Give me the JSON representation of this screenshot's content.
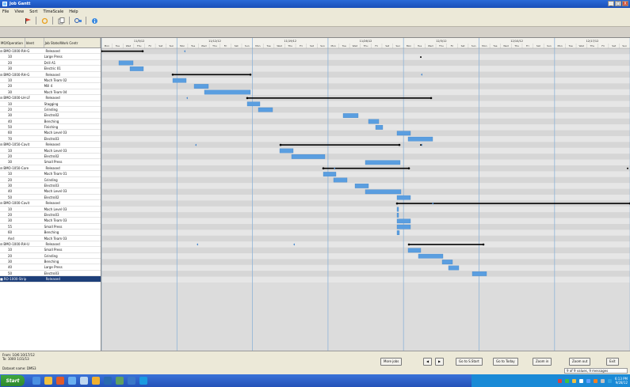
{
  "window": {
    "title": "Job Gantt",
    "controls": [
      "_",
      "□",
      "X"
    ]
  },
  "menu": [
    "File",
    "View",
    "Sort",
    "TimeScale",
    "Help"
  ],
  "toolbar": {
    "icons": [
      "flag-icon",
      "refresh-icon",
      "copy-icon",
      "zoom-icon",
      "info-icon"
    ]
  },
  "grid": {
    "headers": [
      "MO/Operation",
      "Ident",
      "Job State/Work Centr"
    ],
    "rows": [
      {
        "type": "parent",
        "c1": "BMO-1000-RH-G",
        "c2": "Released"
      },
      {
        "type": "child",
        "c1": "10",
        "c2": "Large Press"
      },
      {
        "type": "child",
        "c1": "20",
        "c2": "Drill A1"
      },
      {
        "type": "child",
        "c1": "30",
        "c2": "Electric 01"
      },
      {
        "type": "parent",
        "c1": "BMO-1000-RH-G",
        "c2": "Released"
      },
      {
        "type": "child",
        "c1": "10",
        "c2": "Mach Team 02"
      },
      {
        "type": "child",
        "c1": "20",
        "c2": "Mill 4"
      },
      {
        "type": "child",
        "c1": "30",
        "c2": "Mach Team 04"
      },
      {
        "type": "parent",
        "c1": "BMO-1000-LH-LF",
        "c2": "Released"
      },
      {
        "type": "child",
        "c1": "10",
        "c2": "Stagging"
      },
      {
        "type": "child",
        "c1": "20",
        "c2": "Grinding"
      },
      {
        "type": "child",
        "c1": "30",
        "c2": "Electro02"
      },
      {
        "type": "child",
        "c1": "40",
        "c2": "Benching"
      },
      {
        "type": "child",
        "c1": "50",
        "c2": "Finishing"
      },
      {
        "type": "child",
        "c1": "60",
        "c2": "Mach Level 03"
      },
      {
        "type": "child",
        "c1": "70",
        "c2": "Electro03"
      },
      {
        "type": "parent",
        "c1": "BMO-1050-Cavit",
        "c2": "Released"
      },
      {
        "type": "child",
        "c1": "10",
        "c2": "Mach Level 03"
      },
      {
        "type": "child",
        "c1": "20",
        "c2": "Electro02"
      },
      {
        "type": "child",
        "c1": "30",
        "c2": "Small Press"
      },
      {
        "type": "parent",
        "c1": "BMO-1050-Core",
        "c2": "Released"
      },
      {
        "type": "child",
        "c1": "10",
        "c2": "Mach Team 01"
      },
      {
        "type": "child",
        "c1": "20",
        "c2": "Grinding"
      },
      {
        "type": "child",
        "c1": "30",
        "c2": "Electro03"
      },
      {
        "type": "child",
        "c1": "40",
        "c2": "Mach Level 03"
      },
      {
        "type": "child",
        "c1": "50",
        "c2": "Electro02"
      },
      {
        "type": "parent",
        "c1": "BMO-1000-Cavit",
        "c2": "Released"
      },
      {
        "type": "child",
        "c1": "10",
        "c2": "Mach Level 03"
      },
      {
        "type": "child",
        "c1": "20",
        "c2": "Electro03"
      },
      {
        "type": "child",
        "c1": "30",
        "c2": "Mach Team 03"
      },
      {
        "type": "child",
        "c1": "55",
        "c2": "Small Press"
      },
      {
        "type": "child",
        "c1": "60",
        "c2": "Benching"
      },
      {
        "type": "child",
        "c1": "And",
        "c2": "Mach Team 03"
      },
      {
        "type": "parent",
        "c1": "BMO-1000-RH-U",
        "c2": "Released"
      },
      {
        "type": "child",
        "c1": "10",
        "c2": "Small Press"
      },
      {
        "type": "child",
        "c1": "20",
        "c2": "Grinding"
      },
      {
        "type": "child",
        "c1": "30",
        "c2": "Benching"
      },
      {
        "type": "child",
        "c1": "40",
        "c2": "Large Press"
      },
      {
        "type": "child",
        "c1": "50",
        "c2": "Electro03"
      },
      {
        "type": "selected",
        "c1": "RO-1000-Strip",
        "c2": "Released"
      }
    ]
  },
  "timescale": {
    "weeks": [
      "11/5/12",
      "11/12/12",
      "11/19/12",
      "11/26/12",
      "12/3/12",
      "12/10/12",
      "12/17/12",
      "12/24/12"
    ],
    "days": [
      "Mon",
      "Tue",
      "Wed",
      "Thu",
      "Fri",
      "Sat",
      "Sun"
    ]
  },
  "bottom": {
    "from_label": "From: 10/6 10/17/12",
    "to_label": "To:   1000 1/31/13",
    "dataset": "Dataset name: DMS3",
    "buttons": {
      "more_jobs": "More jobs",
      "prev": "◀",
      "next": "▶",
      "go_start": "Go to S.Start",
      "go_today": "Go to Today",
      "zoom_in": "Zoom in",
      "zoom_out": "Zoom out",
      "exit": "Exit"
    },
    "status": "9 of 9 values, 9 messages"
  },
  "taskbar": {
    "start": "Start",
    "clock_time": "6:13 PM",
    "clock_date": "9/28/12"
  }
}
